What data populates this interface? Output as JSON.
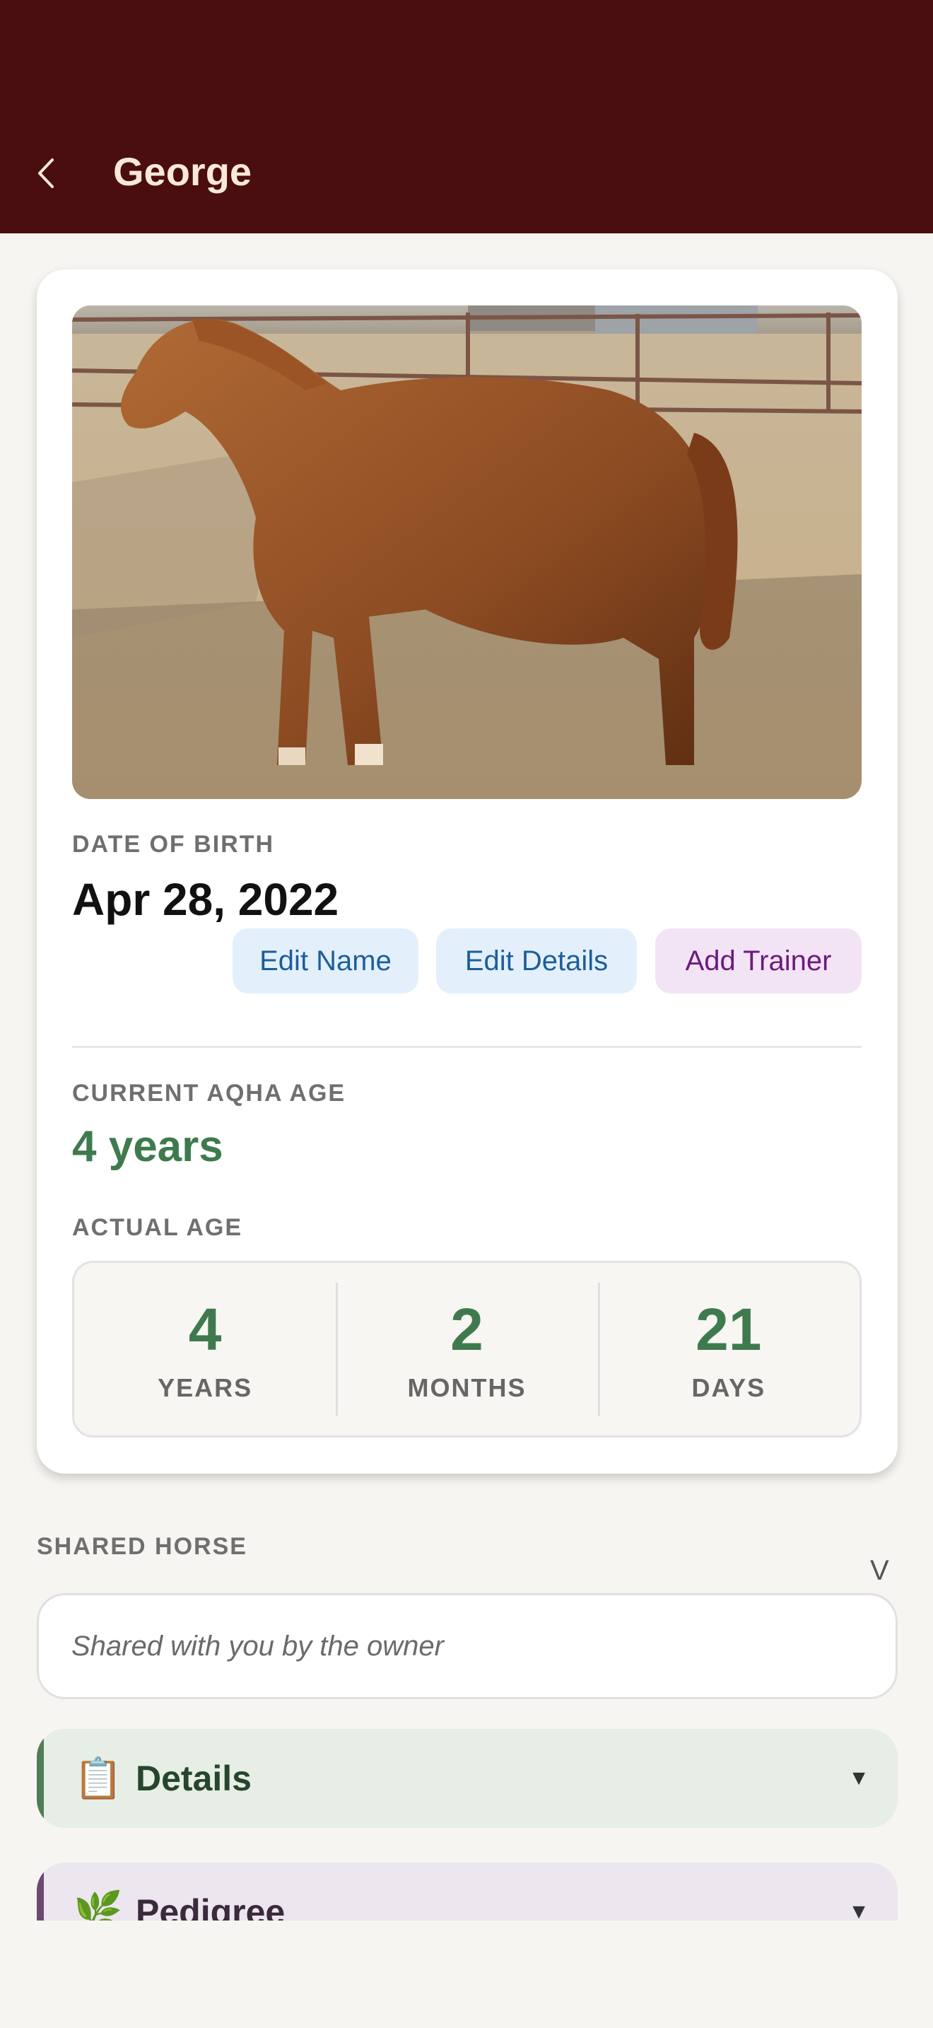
{
  "header": {
    "title": "George",
    "back_icon": "chevron-left-icon",
    "background": "#4a0e10"
  },
  "profile": {
    "photo_description_icon": "horse-photo",
    "dob_label": "DATE OF BIRTH",
    "dob_value": "Apr 28, 2022",
    "actions": {
      "edit_name": "Edit Name",
      "edit_details": "Edit Details",
      "add_trainer": "Add Trainer"
    },
    "aqha_label": "CURRENT AQHA AGE",
    "aqha_value": "4 years",
    "actual_age_label": "ACTUAL AGE",
    "actual_age": [
      {
        "value": "4",
        "unit": "YEARS"
      },
      {
        "value": "2",
        "unit": "MONTHS"
      },
      {
        "value": "21",
        "unit": "DAYS"
      }
    ],
    "accent_green": "#3f7a4f"
  },
  "shared": {
    "label": "SHARED HORSE",
    "toggle_glyph": "V",
    "note": "Shared with you by the owner"
  },
  "sections": [
    {
      "icon": "clipboard-icon",
      "glyph": "📋",
      "title": "Details",
      "caret": "▼",
      "bg": "#e6eee6",
      "bar": "#4f7d56",
      "text": "#27452c"
    },
    {
      "icon": "herb-icon",
      "glyph": "🌿",
      "title": "Pedigree",
      "caret": "▼",
      "bg": "#ece6ee",
      "bar": "#6b4a6e",
      "text": "#3a2a3c"
    }
  ]
}
